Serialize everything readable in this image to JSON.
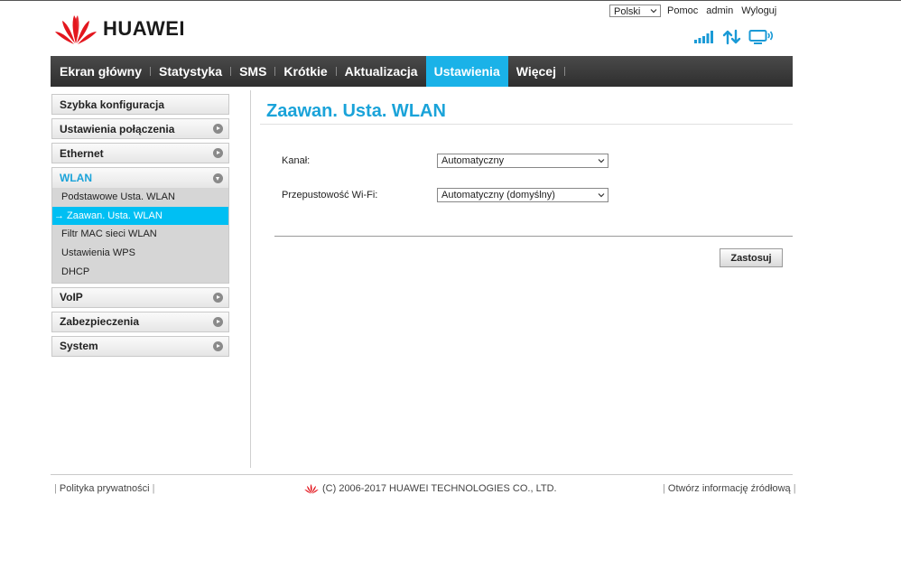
{
  "header": {
    "language": "Polski",
    "links": [
      "Pomoc",
      "admin",
      "Wyloguj"
    ],
    "brand": "HUAWEI"
  },
  "nav": {
    "items": [
      "Ekran główny",
      "Statystyka",
      "SMS",
      "Krótkie",
      "Aktualizacja",
      "Ustawienia",
      "Więcej"
    ],
    "active": "Ustawienia"
  },
  "sidebar": {
    "quick": "Szybka konfiguracja",
    "connection": "Ustawienia połączenia",
    "ethernet": "Ethernet",
    "wlan": "WLAN",
    "wlan_sub": [
      "Podstawowe Usta. WLAN",
      "Zaawan. Usta. WLAN",
      "Filtr MAC sieci WLAN",
      "Ustawienia WPS",
      "DHCP"
    ],
    "wlan_active": "→ Zaawan. Usta. WLAN",
    "voip": "VoIP",
    "security": "Zabezpieczenia",
    "system": "System"
  },
  "main": {
    "title": "Zaawan. Usta. WLAN",
    "channel_label": "Kanał:",
    "channel_value": "Automatyczny",
    "bandwidth_label": "Przepustowość Wi-Fi:",
    "bandwidth_value": "Automatyczny (domyślny)",
    "apply_label": "Zastosuj"
  },
  "footer": {
    "privacy": "Polityka prywatności",
    "copyright": "(C) 2006-2017 HUAWEI TECHNOLOGIES CO., LTD.",
    "opensource": "Otwórz informację źródłową"
  },
  "colors": {
    "accent": "#1ab2e8",
    "nav_bg": "#3a3a3a",
    "brand_red": "#e3161e"
  }
}
